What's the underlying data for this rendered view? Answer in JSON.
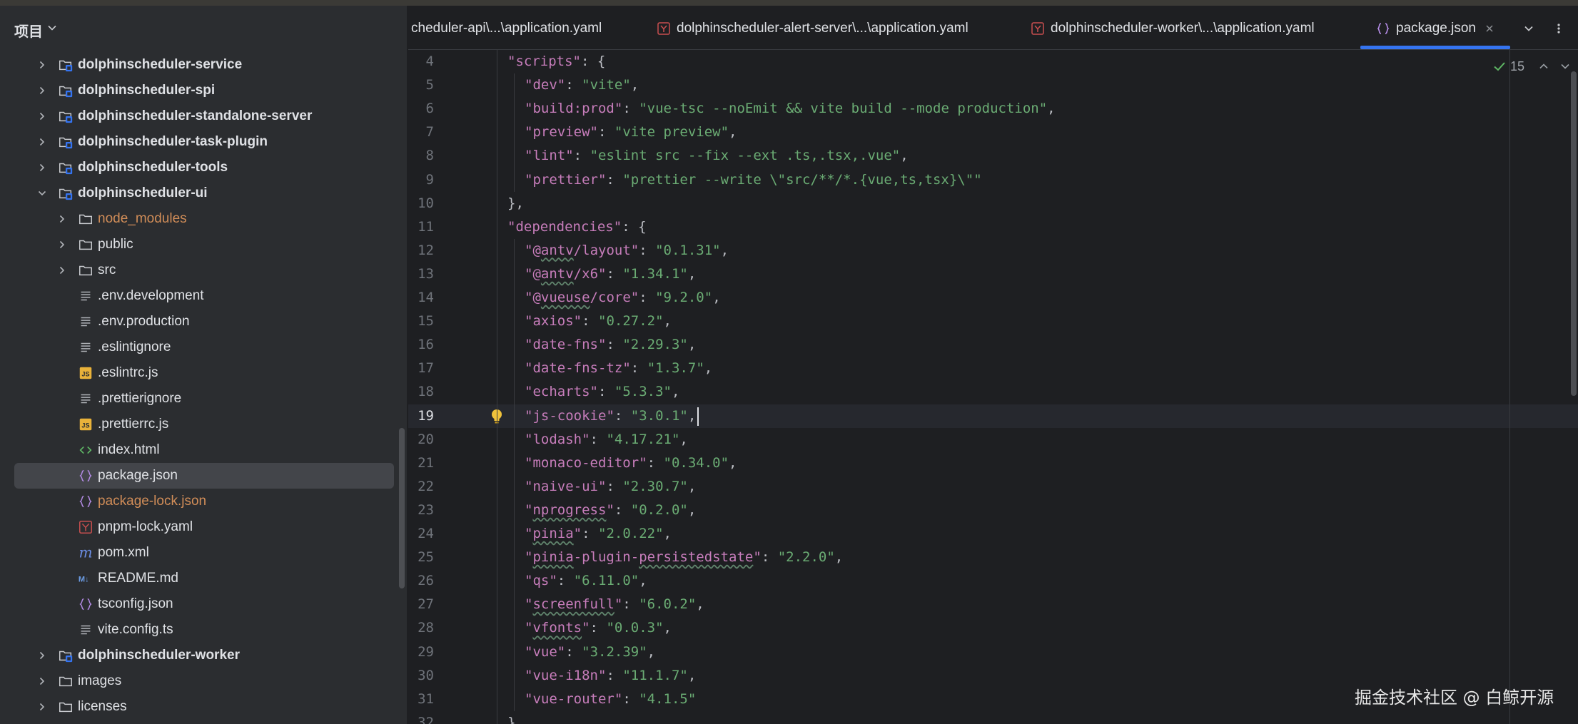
{
  "top_bar": {
    "accent_colors": [
      "#5b8f52",
      "#c94f4f"
    ]
  },
  "project_panel": {
    "title": "项目",
    "items": [
      {
        "label": "dolphinscheduler-service",
        "kind": "module",
        "expanded": false,
        "bold": true
      },
      {
        "label": "dolphinscheduler-spi",
        "kind": "module",
        "expanded": false,
        "bold": true
      },
      {
        "label": "dolphinscheduler-standalone-server",
        "kind": "module",
        "expanded": false,
        "bold": true
      },
      {
        "label": "dolphinscheduler-task-plugin",
        "kind": "module",
        "expanded": false,
        "bold": true
      },
      {
        "label": "dolphinscheduler-tools",
        "kind": "module",
        "expanded": false,
        "bold": true
      },
      {
        "label": "dolphinscheduler-ui",
        "kind": "module",
        "expanded": true,
        "bold": true
      },
      {
        "label": "node_modules",
        "kind": "folder",
        "expanded": false,
        "excluded": true
      },
      {
        "label": "public",
        "kind": "folder",
        "expanded": false
      },
      {
        "label": "src",
        "kind": "folder",
        "expanded": false
      },
      {
        "label": ".env.development",
        "kind": "text-file"
      },
      {
        "label": ".env.production",
        "kind": "text-file"
      },
      {
        "label": ".eslintignore",
        "kind": "text-file"
      },
      {
        "label": ".eslintrc.js",
        "kind": "js-file"
      },
      {
        "label": ".prettierignore",
        "kind": "text-file"
      },
      {
        "label": ".prettierrc.js",
        "kind": "js-file"
      },
      {
        "label": "index.html",
        "kind": "html-file"
      },
      {
        "label": "package.json",
        "kind": "json-file",
        "selected": true
      },
      {
        "label": "package-lock.json",
        "kind": "json-file",
        "excluded": true
      },
      {
        "label": "pnpm-lock.yaml",
        "kind": "yaml-file"
      },
      {
        "label": "pom.xml",
        "kind": "maven-file"
      },
      {
        "label": "README.md",
        "kind": "markdown-file"
      },
      {
        "label": "tsconfig.json",
        "kind": "json-file"
      },
      {
        "label": "vite.config.ts",
        "kind": "text-file"
      },
      {
        "label": "dolphinscheduler-worker",
        "kind": "module",
        "expanded": false,
        "bold": true
      },
      {
        "label": "images",
        "kind": "folder",
        "expanded": false
      },
      {
        "label": "licenses",
        "kind": "folder",
        "expanded": false
      }
    ]
  },
  "tabs": [
    {
      "label": "cheduler-api\\...\\application.yaml",
      "icon": "none"
    },
    {
      "label": "dolphinscheduler-alert-server\\...\\application.yaml",
      "icon": "yaml-file-icon"
    },
    {
      "label": "dolphinscheduler-worker\\...\\application.yaml",
      "icon": "yaml-file-icon"
    },
    {
      "label": "package.json",
      "icon": "json-file-icon",
      "active": true,
      "closable": true
    }
  ],
  "editor": {
    "inspection_count": "15",
    "current_line": "19",
    "lines": [
      {
        "n": "4",
        "indent": 1,
        "segs": [
          [
            "k",
            "\"scripts\""
          ],
          [
            "p",
            ": {"
          ]
        ]
      },
      {
        "n": "5",
        "indent": 2,
        "segs": [
          [
            "k",
            "\"dev\""
          ],
          [
            "p",
            ": "
          ],
          [
            "s",
            "\"vite\""
          ],
          [
            "p",
            ","
          ]
        ]
      },
      {
        "n": "6",
        "indent": 2,
        "segs": [
          [
            "k",
            "\"build:prod\""
          ],
          [
            "p",
            ": "
          ],
          [
            "s",
            "\"vue-tsc --noEmit && vite build --mode production\""
          ],
          [
            "p",
            ","
          ]
        ]
      },
      {
        "n": "7",
        "indent": 2,
        "segs": [
          [
            "k",
            "\"preview\""
          ],
          [
            "p",
            ": "
          ],
          [
            "s",
            "\"vite preview\""
          ],
          [
            "p",
            ","
          ]
        ]
      },
      {
        "n": "8",
        "indent": 2,
        "segs": [
          [
            "k",
            "\"lint\""
          ],
          [
            "p",
            ": "
          ],
          [
            "s",
            "\"eslint src --fix --ext .ts,.tsx,.vue\""
          ],
          [
            "p",
            ","
          ]
        ]
      },
      {
        "n": "9",
        "indent": 2,
        "segs": [
          [
            "k",
            "\"prettier\""
          ],
          [
            "p",
            ": "
          ],
          [
            "s",
            "\"prettier --write \\\"src/**/*.{vue,ts,tsx}\\\"\""
          ]
        ]
      },
      {
        "n": "10",
        "indent": 1,
        "segs": [
          [
            "p",
            "},"
          ]
        ]
      },
      {
        "n": "11",
        "indent": 1,
        "segs": [
          [
            "k",
            "\"dependencies\""
          ],
          [
            "p",
            ": {"
          ]
        ]
      },
      {
        "n": "12",
        "indent": 2,
        "segs": [
          [
            "k",
            "\"@antv/layout\""
          ],
          [
            "p",
            ": "
          ],
          [
            "s",
            "\"0.1.31\""
          ],
          [
            "p",
            ","
          ]
        ]
      },
      {
        "n": "13",
        "indent": 2,
        "segs": [
          [
            "k",
            "\"@antv/x6\""
          ],
          [
            "p",
            ": "
          ],
          [
            "s",
            "\"1.34.1\""
          ],
          [
            "p",
            ","
          ]
        ]
      },
      {
        "n": "14",
        "indent": 2,
        "segs": [
          [
            "k",
            "\"@vueuse/core\""
          ],
          [
            "p",
            ": "
          ],
          [
            "s",
            "\"9.2.0\""
          ],
          [
            "p",
            ","
          ]
        ]
      },
      {
        "n": "15",
        "indent": 2,
        "segs": [
          [
            "k",
            "\"axios\""
          ],
          [
            "p",
            ": "
          ],
          [
            "s",
            "\"0.27.2\""
          ],
          [
            "p",
            ","
          ]
        ]
      },
      {
        "n": "16",
        "indent": 2,
        "segs": [
          [
            "k",
            "\"date-fns\""
          ],
          [
            "p",
            ": "
          ],
          [
            "s",
            "\"2.29.3\""
          ],
          [
            "p",
            ","
          ]
        ]
      },
      {
        "n": "17",
        "indent": 2,
        "segs": [
          [
            "k",
            "\"date-fns-tz\""
          ],
          [
            "p",
            ": "
          ],
          [
            "s",
            "\"1.3.7\""
          ],
          [
            "p",
            ","
          ]
        ]
      },
      {
        "n": "18",
        "indent": 2,
        "segs": [
          [
            "k",
            "\"echarts\""
          ],
          [
            "p",
            ": "
          ],
          [
            "s",
            "\"5.3.3\""
          ],
          [
            "p",
            ","
          ]
        ]
      },
      {
        "n": "19",
        "indent": 2,
        "segs": [
          [
            "k",
            "\"js-cookie\""
          ],
          [
            "p",
            ": "
          ],
          [
            "s",
            "\"3.0.1\""
          ],
          [
            "p",
            ","
          ]
        ]
      },
      {
        "n": "20",
        "indent": 2,
        "segs": [
          [
            "k",
            "\"lodash\""
          ],
          [
            "p",
            ": "
          ],
          [
            "s",
            "\"4.17.21\""
          ],
          [
            "p",
            ","
          ]
        ]
      },
      {
        "n": "21",
        "indent": 2,
        "segs": [
          [
            "k",
            "\"monaco-editor\""
          ],
          [
            "p",
            ": "
          ],
          [
            "s",
            "\"0.34.0\""
          ],
          [
            "p",
            ","
          ]
        ]
      },
      {
        "n": "22",
        "indent": 2,
        "segs": [
          [
            "k",
            "\"naive-ui\""
          ],
          [
            "p",
            ": "
          ],
          [
            "s",
            "\"2.30.7\""
          ],
          [
            "p",
            ","
          ]
        ]
      },
      {
        "n": "23",
        "indent": 2,
        "segs": [
          [
            "k",
            "\"nprogress\""
          ],
          [
            "p",
            ": "
          ],
          [
            "s",
            "\"0.2.0\""
          ],
          [
            "p",
            ","
          ]
        ]
      },
      {
        "n": "24",
        "indent": 2,
        "segs": [
          [
            "k",
            "\"pinia\""
          ],
          [
            "p",
            ": "
          ],
          [
            "s",
            "\"2.0.22\""
          ],
          [
            "p",
            ","
          ]
        ]
      },
      {
        "n": "25",
        "indent": 2,
        "segs": [
          [
            "k",
            "\"pinia-plugin-persistedstate\""
          ],
          [
            "p",
            ": "
          ],
          [
            "s",
            "\"2.2.0\""
          ],
          [
            "p",
            ","
          ]
        ]
      },
      {
        "n": "26",
        "indent": 2,
        "segs": [
          [
            "k",
            "\"qs\""
          ],
          [
            "p",
            ": "
          ],
          [
            "s",
            "\"6.11.0\""
          ],
          [
            "p",
            ","
          ]
        ]
      },
      {
        "n": "27",
        "indent": 2,
        "segs": [
          [
            "k",
            "\"screenfull\""
          ],
          [
            "p",
            ": "
          ],
          [
            "s",
            "\"6.0.2\""
          ],
          [
            "p",
            ","
          ]
        ]
      },
      {
        "n": "28",
        "indent": 2,
        "segs": [
          [
            "k",
            "\"vfonts\""
          ],
          [
            "p",
            ": "
          ],
          [
            "s",
            "\"0.0.3\""
          ],
          [
            "p",
            ","
          ]
        ]
      },
      {
        "n": "29",
        "indent": 2,
        "segs": [
          [
            "k",
            "\"vue\""
          ],
          [
            "p",
            ": "
          ],
          [
            "s",
            "\"3.2.39\""
          ],
          [
            "p",
            ","
          ]
        ]
      },
      {
        "n": "30",
        "indent": 2,
        "segs": [
          [
            "k",
            "\"vue-i18n\""
          ],
          [
            "p",
            ": "
          ],
          [
            "s",
            "\"11.1.7\""
          ],
          [
            "p",
            ","
          ]
        ]
      },
      {
        "n": "31",
        "indent": 2,
        "segs": [
          [
            "k",
            "\"vue-router\""
          ],
          [
            "p",
            ": "
          ],
          [
            "s",
            "\"4.1.5\""
          ]
        ]
      },
      {
        "n": "32",
        "indent": 1,
        "segs": [
          [
            "p",
            "},"
          ]
        ]
      }
    ],
    "typo_words": [
      "antv",
      "vueuse",
      "nprogress",
      "pinia",
      "persistedstate",
      "screenfull",
      "vfonts"
    ]
  },
  "watermark": "掘金技术社区 @ 白鲸开源",
  "colors": {
    "key": "#c77dbb",
    "string": "#6aab73",
    "punct": "#bcbec4",
    "accent": "#3574f0",
    "excluded": "#d18d58",
    "background": "#1e1f22",
    "panel": "#2b2d30"
  }
}
